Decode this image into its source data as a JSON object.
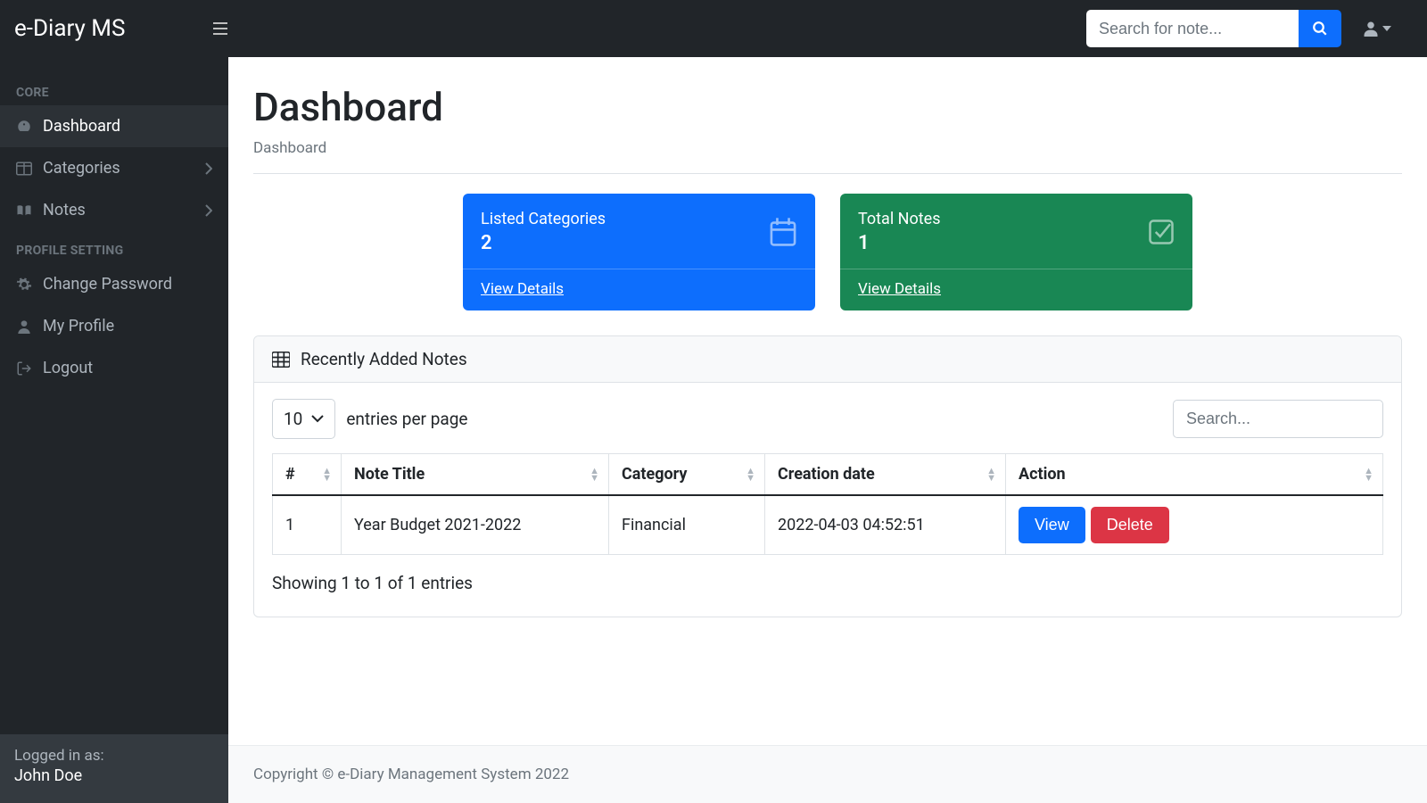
{
  "brand": "e-Diary MS",
  "search": {
    "placeholder": "Search for note..."
  },
  "sidebar": {
    "sections": [
      {
        "heading": "CORE",
        "items": [
          {
            "label": "Dashboard",
            "icon": "tachometer",
            "active": true,
            "expandable": false
          },
          {
            "label": "Categories",
            "icon": "columns",
            "active": false,
            "expandable": true
          },
          {
            "label": "Notes",
            "icon": "book",
            "active": false,
            "expandable": true
          }
        ]
      },
      {
        "heading": "PROFILE SETTING",
        "items": [
          {
            "label": "Change Password",
            "icon": "gear",
            "active": false,
            "expandable": false
          },
          {
            "label": "My Profile",
            "icon": "user",
            "active": false,
            "expandable": false
          },
          {
            "label": "Logout",
            "icon": "signout",
            "active": false,
            "expandable": false
          }
        ]
      }
    ],
    "footer": {
      "label": "Logged in as:",
      "name": "John Doe"
    }
  },
  "page": {
    "title": "Dashboard",
    "breadcrumb": "Dashboard"
  },
  "stat_cards": [
    {
      "label": "Listed Categories",
      "value": "2",
      "link": "View Details",
      "color": "blue",
      "icon": "calendar"
    },
    {
      "label": "Total Notes",
      "value": "1",
      "link": "View Details",
      "color": "green",
      "icon": "check-square"
    }
  ],
  "table": {
    "title": "Recently Added Notes",
    "entries_value": "10",
    "entries_label": "entries per page",
    "search_placeholder": "Search...",
    "columns": [
      "#",
      "Note Title",
      "Category",
      "Creation date",
      "Action"
    ],
    "rows": [
      {
        "num": "1",
        "title": "Year Budget 2021-2022",
        "category": "Financial",
        "date": "2022-04-03 04:52:51",
        "view": "View",
        "delete": "Delete"
      }
    ],
    "info": "Showing 1 to 1 of 1 entries"
  },
  "footer": "Copyright © e-Diary Management System 2022"
}
